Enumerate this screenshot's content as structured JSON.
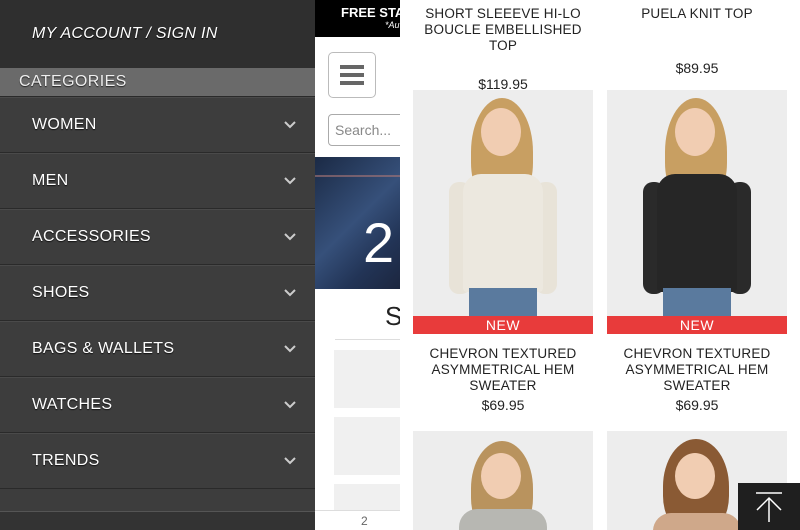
{
  "drawer": {
    "account_label": "MY ACCOUNT / SIGN IN",
    "categories_header": "CATEGORIES",
    "items": [
      {
        "label": "WOMEN"
      },
      {
        "label": "MEN"
      },
      {
        "label": "ACCESSORIES"
      },
      {
        "label": "SHOES"
      },
      {
        "label": "BAGS & WALLETS"
      },
      {
        "label": "WATCHES"
      },
      {
        "label": "TRENDS"
      }
    ]
  },
  "main": {
    "banner_text": "FREE STA",
    "banner_sub": "*Au",
    "search_placeholder": "Search...",
    "hero_number": "2",
    "section_letter": "S",
    "bottom_text": "2"
  },
  "products": [
    {
      "name": "SHORT SLEEEVE HI-LO BOUCLE EMBELLISHED TOP",
      "price": "$119.95"
    },
    {
      "name": "PUELA KNIT TOP",
      "price": "$89.95"
    },
    {
      "name": "CHEVRON TEXTURED ASYMMETRICAL HEM SWEATER",
      "price": "$69.95",
      "badge": "NEW"
    },
    {
      "name": "CHEVRON TEXTURED ASYMMETRICAL HEM SWEATER",
      "price": "$69.95",
      "badge": "NEW"
    }
  ],
  "colors": {
    "drawer_bg": "#3d3d3d",
    "badge_red": "#e83b3b"
  },
  "icons": {
    "chevron": "chevron-down-icon",
    "menu": "hamburger-menu-icon",
    "back_to_top": "arrow-up-icon"
  }
}
